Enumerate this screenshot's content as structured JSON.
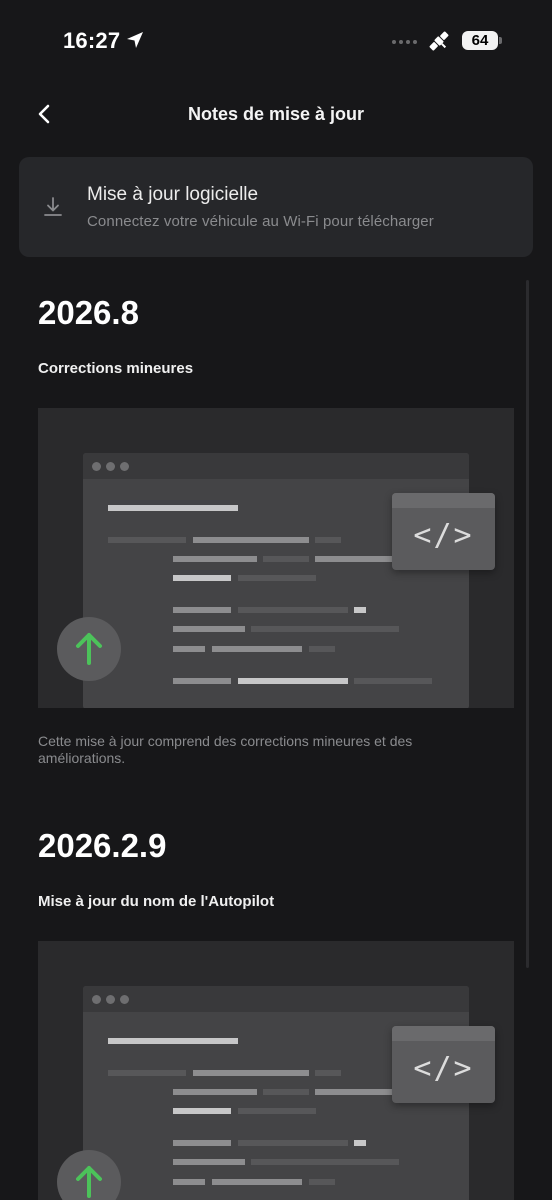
{
  "status_bar": {
    "time": "16:27",
    "battery": "64",
    "icons": [
      "location-arrow-icon",
      "signal-dots-icon",
      "satellite-icon",
      "battery-icon"
    ]
  },
  "header": {
    "back_icon": "chevron-left-icon",
    "title": "Notes de mise à jour"
  },
  "update_card": {
    "icon": "download-icon",
    "title": "Mise à jour logicielle",
    "subtitle": "Connectez votre véhicule au Wi-Fi pour télécharger"
  },
  "releases": [
    {
      "version": "2026.8",
      "heading": "Corrections mineures",
      "description": "Cette mise à jour comprend des corrections mineures et des améliorations."
    },
    {
      "version": "2026.2.9",
      "heading": "Mise à jour du nom de l'Autopilot"
    }
  ],
  "illustration": {
    "code_glyph": "</>",
    "arrow_icon": "arrow-up-icon",
    "colors": {
      "arrow": "#4cc35a",
      "background": "#2a2a2c",
      "window": "#444446"
    }
  },
  "colors": {
    "page_bg": "#171719",
    "card_bg": "#26272a",
    "text_primary": "#ffffff",
    "text_secondary": "#8a8b8e"
  }
}
